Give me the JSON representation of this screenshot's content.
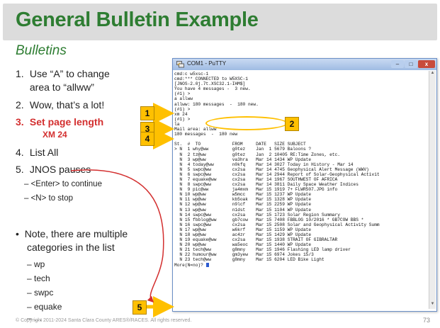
{
  "slide": {
    "title": "General Bulletin Example",
    "subtitle": "Bulletins",
    "steps": [
      {
        "num": "1.",
        "text": "Use “A” to change"
      },
      {
        "num": "",
        "text": "area to “allww”"
      },
      {
        "num": "2.",
        "text": "Wow, that’s a lot!"
      },
      {
        "num": "3.",
        "text": "Set page length"
      },
      {
        "num": "4.",
        "text": "List All"
      },
      {
        "num": "5.",
        "text": "JNOS pauses"
      }
    ],
    "xm_note": "XM 24",
    "pause_options": [
      "–  <Enter> to continue",
      "–  <N> to stop"
    ],
    "note_line1": "Note, there are multiple",
    "note_line2": "categories in the list",
    "categories": [
      "–  wp",
      "–  tech",
      "–  swpc",
      "–  equake",
      "–  …"
    ],
    "footer": "© Copyright 2011-2024 Santa Clara County ARES®/RACES. All rights reserved.",
    "page_number": "73"
  },
  "window": {
    "title": "COM1 - PuTTY",
    "min_label": "–",
    "max_label": "□",
    "close_label": "x"
  },
  "callouts": [
    "1",
    "2",
    "3",
    "4",
    "5"
  ],
  "terminal": {
    "lines": [
      "cmd:c w5xsc-1",
      "cmd:*** CONNECTED to W5XSC-1",
      "[JNOS-2.0j.7t.XSC32.1-IHM$]",
      "You have 4 messages -  3 new.",
      "(#1) >",
      "a allww",
      "allww: 180 messages  -  180 new.",
      "(#1) >",
      "xm 24",
      "(#1) >",
      "la",
      "Mail area: allww",
      "180 messages  -  180 new",
      "",
      "St.  #  TO            FROM     DATE   SIZE SUBJECT",
      "> N  1 why@ww         g0tez    Jan  1 5679 Baloons ?",
      "  N  2 tz@ww          g0tez    Jan  2 10405 RE:Time Zones, etc.",
      "  N  3 wp@ww          va3hra   Mar 14 1434 WP Update",
      "  N  4 today@ww       n0kfq    Mar 14 3027 Today in History - Mar 14",
      "  N  5 swpc@ww        cx2sa    Mar 14 4745 Geophysical Alert Message (WWV)",
      "  N  6 swpc@ww        cx2sa    Mar 14 2944 Report of Solar-Geophysical Activit",
      "  N  7 equake@ww      cx2sa    Mar 14 1967 SOUTHWEST OF AFRICA",
      "  N  8 swpc@ww        cx2sa    Mar 14 3811 Daily Space Weather Indices",
      "  N  9 pic@ww         ja4mxm   Mar 15 1919 7+ FLWR507.JPG info",
      "  N 10 wp@ww          w5mcc    Mar 15 1237 WP Update",
      "  N 11 wp@ww          kb5oak   Mar 15 1328 WP Update",
      "  N 12 wp@ww          n9lcf    Mar 15 2259 WP Update",
      "  N 13 wp@ww          n1dst    Mar 15 1104 WP Update",
      "  N 14 swpc@ww        cx2sa    Mar 15 1723 Solar Region Summary",
      "  N 15 fbblog@ww      gb7cow   Mar 15 7408 FBBLOG 10/2016 * GB7COW BBS *",
      "  N 16 swpc@ww        cx2sa    Mar 15 2508 Solar and Geophysical Activity Summ",
      "  N 17 wp@ww          w6krf    Mar 15 1159 WP Update",
      "  N 18 wp@ww          ac4zr    Mar 15 1429 WP Update",
      "  N 19 equake@ww      cx2sa    Mar 15 1938 STRAIT OF GIBRALTAR",
      "  N 20 wp@ww          wa5eoc   Mar 15 1440 WP Update",
      "  N 21 tech@ww        g8mny    Mar 15 1946 Flashing LED lamp driver",
      "  N 22 humour@ww      gm3yew   Mar 15 6974 Jokes 15/3",
      "  N 23 tech@ww        g8mny    Mar 15 6204 LED Bike Light",
      "More(N=no)? "
    ]
  },
  "colors": {
    "title_green": "#2e7d32",
    "highlight_red": "#d32f2f",
    "callout_yellow": "#ffc000",
    "titlebar_blue": "#9fbbe3",
    "cursor_blue": "#2d5bd0"
  }
}
